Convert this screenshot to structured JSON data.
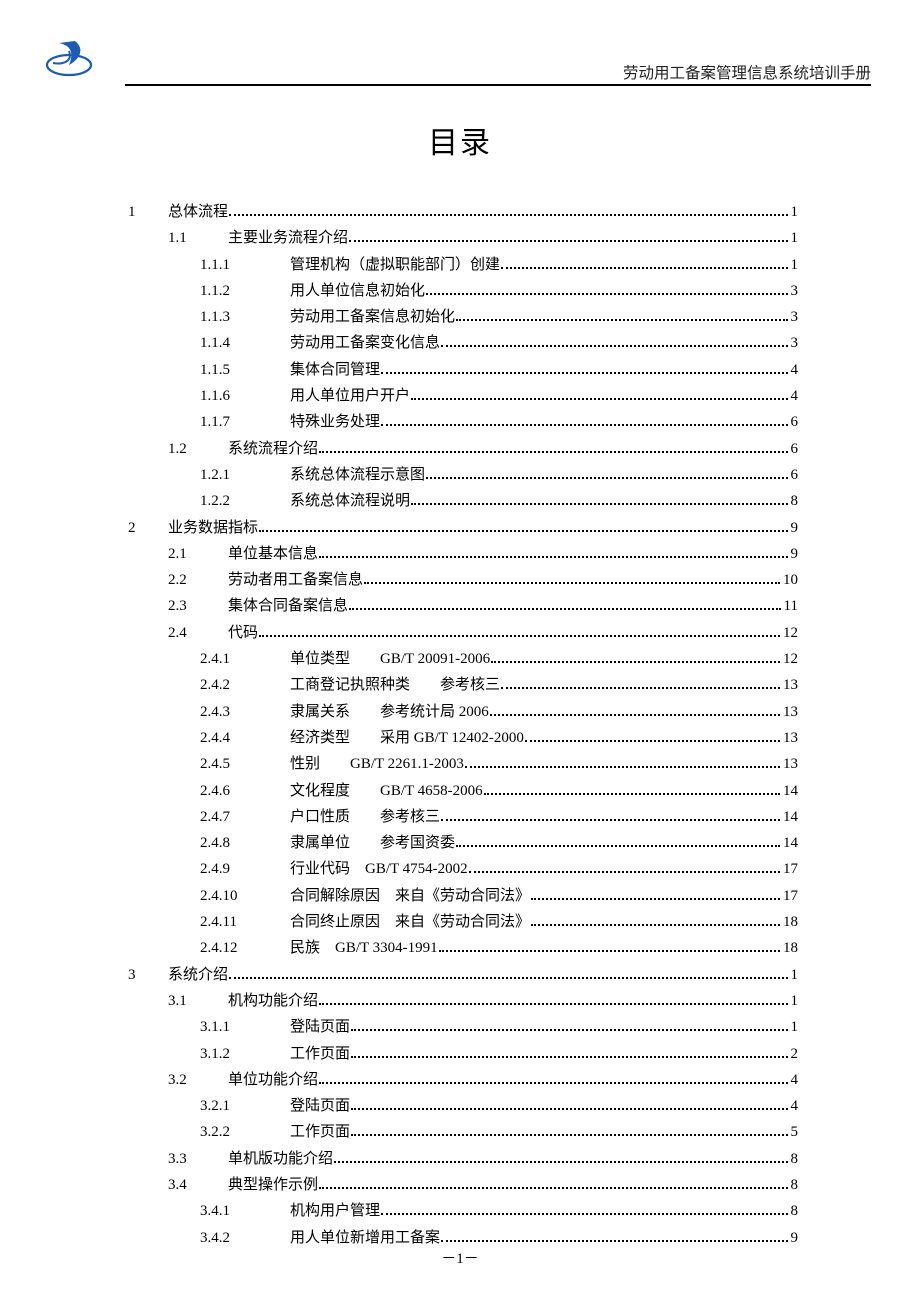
{
  "header": {
    "text": "劳动用工备案管理信息系统培训手册"
  },
  "title": "目录",
  "pagenum": "－1－",
  "toc": [
    {
      "level": 0,
      "num": "1",
      "label": "总体流程",
      "page": "1"
    },
    {
      "level": 1,
      "num": "1.1",
      "label": "主要业务流程介绍",
      "page": "1"
    },
    {
      "level": 2,
      "num": "1.1.1",
      "label": "管理机构（虚拟职能部门）创建",
      "page": "1"
    },
    {
      "level": 2,
      "num": "1.1.2",
      "label": "用人单位信息初始化",
      "page": "3"
    },
    {
      "level": 2,
      "num": "1.1.3",
      "label": "劳动用工备案信息初始化",
      "page": "3"
    },
    {
      "level": 2,
      "num": "1.1.4",
      "label": "劳动用工备案变化信息",
      "page": "3"
    },
    {
      "level": 2,
      "num": "1.1.5",
      "label": "集体合同管理",
      "page": "4"
    },
    {
      "level": 2,
      "num": "1.1.6",
      "label": "用人单位用户开户",
      "page": "4"
    },
    {
      "level": 2,
      "num": "1.1.7",
      "label": "特殊业务处理",
      "page": "6"
    },
    {
      "level": 1,
      "num": "1.2",
      "label": "系统流程介绍",
      "page": "6"
    },
    {
      "level": 2,
      "num": "1.2.1",
      "label": "系统总体流程示意图",
      "page": "6"
    },
    {
      "level": 2,
      "num": "1.2.2",
      "label": "系统总体流程说明",
      "page": "8"
    },
    {
      "level": 0,
      "num": "2",
      "label": "业务数据指标",
      "page": "9"
    },
    {
      "level": 1,
      "num": "2.1",
      "label": "单位基本信息",
      "page": "9"
    },
    {
      "level": 1,
      "num": "2.2",
      "label": "劳动者用工备案信息",
      "page": "10"
    },
    {
      "level": 1,
      "num": "2.3",
      "label": "集体合同备案信息",
      "page": "11"
    },
    {
      "level": 1,
      "num": "2.4",
      "label": "代码",
      "page": "12"
    },
    {
      "level": 2,
      "num": "2.4.1",
      "label": "单位类型　　GB/T 20091-2006",
      "page": "12"
    },
    {
      "level": 2,
      "num": "2.4.2",
      "label": "工商登记执照种类　　参考核三",
      "page": "13"
    },
    {
      "level": 2,
      "num": "2.4.3",
      "label": "隶属关系　　参考统计局 2006",
      "page": "13"
    },
    {
      "level": 2,
      "num": "2.4.4",
      "label": "经济类型　　采用 GB/T 12402-2000",
      "page": "13"
    },
    {
      "level": 2,
      "num": "2.4.5",
      "label": "性别　　GB/T 2261.1-2003",
      "page": "13"
    },
    {
      "level": 2,
      "num": "2.4.6",
      "label": "文化程度　　GB/T 4658-2006",
      "page": "14"
    },
    {
      "level": 2,
      "num": "2.4.7",
      "label": "户口性质　　参考核三",
      "page": "14"
    },
    {
      "level": 2,
      "num": "2.4.8",
      "label": "隶属单位　　参考国资委",
      "page": "14"
    },
    {
      "level": 2,
      "num": "2.4.9",
      "label": "行业代码　GB/T 4754-2002",
      "page": "17"
    },
    {
      "level": 2,
      "num": "2.4.10",
      "label": "合同解除原因　来自《劳动合同法》",
      "page": "17"
    },
    {
      "level": 2,
      "num": "2.4.11",
      "label": "合同终止原因　来自《劳动合同法》",
      "page": "18"
    },
    {
      "level": 2,
      "num": "2.4.12",
      "label": "民族　GB/T 3304-1991",
      "page": "18"
    },
    {
      "level": 0,
      "num": "3",
      "label": "系统介绍",
      "page": "1"
    },
    {
      "level": 1,
      "num": "3.1",
      "label": "机构功能介绍",
      "page": "1"
    },
    {
      "level": 2,
      "num": "3.1.1",
      "label": "登陆页面",
      "page": "1"
    },
    {
      "level": 2,
      "num": "3.1.2",
      "label": "工作页面",
      "page": "2"
    },
    {
      "level": 1,
      "num": "3.2",
      "label": "单位功能介绍",
      "page": "4"
    },
    {
      "level": 2,
      "num": "3.2.1",
      "label": "登陆页面",
      "page": "4"
    },
    {
      "level": 2,
      "num": "3.2.2",
      "label": "工作页面",
      "page": "5"
    },
    {
      "level": 1,
      "num": "3.3",
      "label": "单机版功能介绍",
      "page": "8"
    },
    {
      "level": 1,
      "num": "3.4",
      "label": "典型操作示例",
      "page": "8"
    },
    {
      "level": 2,
      "num": "3.4.1",
      "label": "机构用户管理",
      "page": "8"
    },
    {
      "level": 2,
      "num": "3.4.2",
      "label": "用人单位新增用工备案",
      "page": "9"
    }
  ]
}
